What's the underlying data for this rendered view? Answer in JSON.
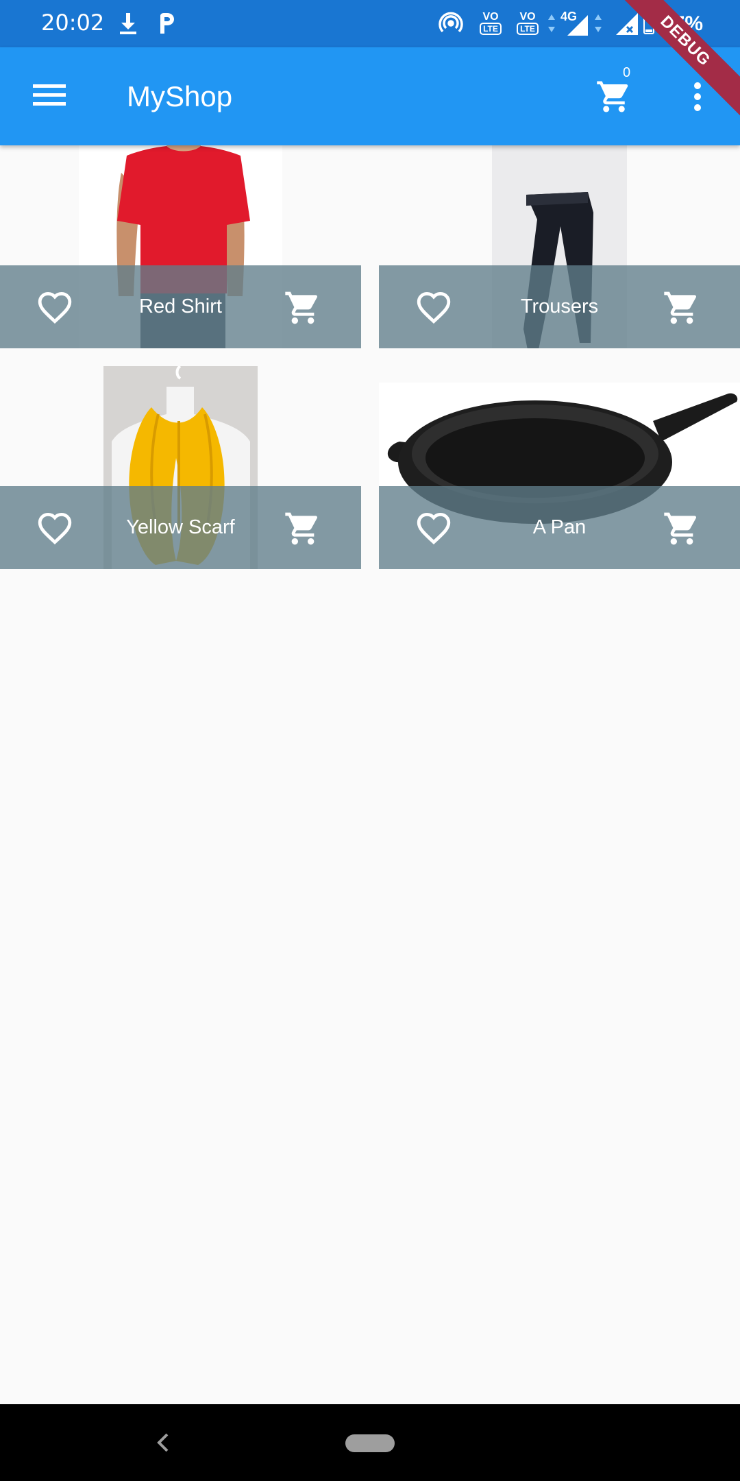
{
  "status_bar": {
    "time": "20:02",
    "battery_percent": "17%",
    "network": "4G",
    "volte1": "VO",
    "volte2": "VO",
    "lte1": "LTE",
    "lte2": "LTE",
    "icons": [
      "download-icon",
      "paytm-icon",
      "hotspot-icon",
      "volte-1-icon",
      "volte-2-icon",
      "signal-4g-icon",
      "signal-no-data-icon",
      "battery-icon"
    ]
  },
  "debug_banner": "DEBUG",
  "app_bar": {
    "title": "MyShop",
    "cart_count": "0",
    "menu_icon": "menu-icon",
    "cart_icon": "shopping-cart-icon",
    "more_icon": "more-vert-icon",
    "background_color": "#2196f3"
  },
  "products": [
    {
      "title": "Red Shirt",
      "image": "red-shirt-image",
      "favorite": false
    },
    {
      "title": "Trousers",
      "image": "trousers-image",
      "favorite": false
    },
    {
      "title": "Yellow Scarf",
      "image": "yellow-scarf-image",
      "favorite": false
    },
    {
      "title": "A Pan",
      "image": "pan-image",
      "favorite": false
    }
  ],
  "nav_bar": {
    "back_icon": "back-icon",
    "home_icon": "home-pill-icon"
  }
}
